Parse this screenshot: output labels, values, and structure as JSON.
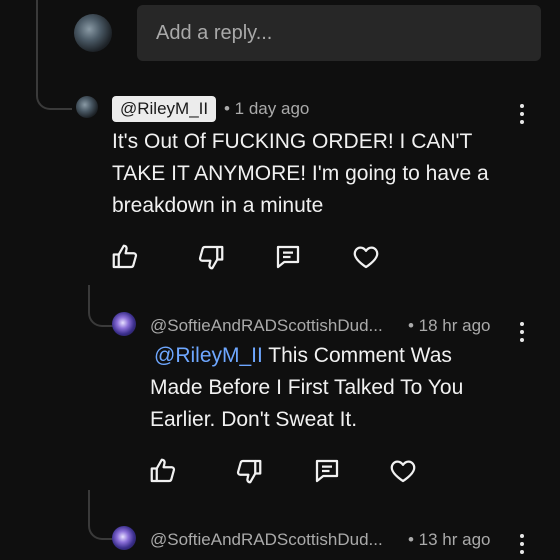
{
  "reply_box": {
    "placeholder": "Add a reply..."
  },
  "comment": {
    "author": "@RileyM_II",
    "time": "• 1 day ago",
    "text": "It's Out Of FUCKING ORDER! I CAN'T TAKE IT ANYMORE! I'm going to have a breakdown in a minute"
  },
  "reply1": {
    "author": "@SoftieAndRADScottishDud...",
    "time": "• 18 hr ago",
    "mention": "@RileyM_II",
    "text": " This Comment Was Made Before I First Talked To You Earlier. Don't Sweat It."
  },
  "reply2": {
    "author": "@SoftieAndRADScottishDud...",
    "time": "• 13 hr ago"
  },
  "icons": {
    "like": "thumbs-up-icon",
    "dislike": "thumbs-down-icon",
    "reply": "comment-icon",
    "heart": "heart-icon",
    "more": "more-vertical-icon"
  }
}
